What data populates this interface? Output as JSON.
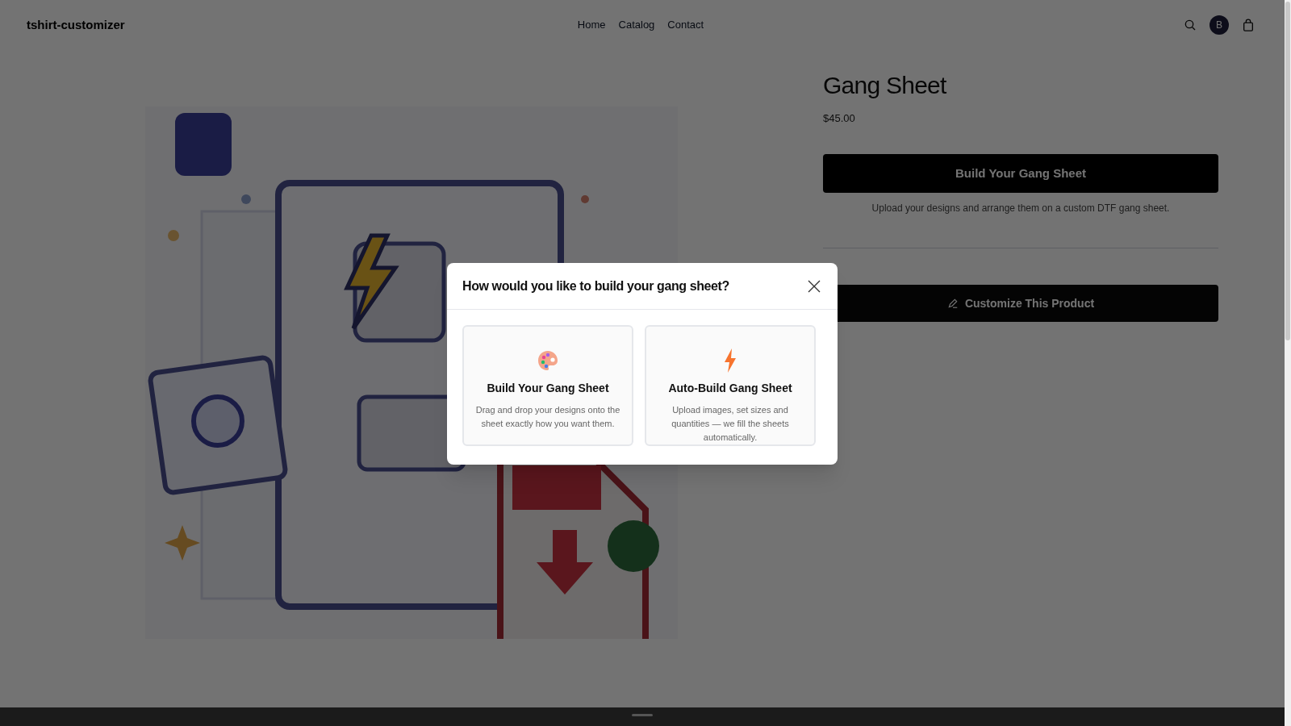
{
  "header": {
    "brand": "tshirt-customizer",
    "nav": [
      {
        "label": "Home"
      },
      {
        "label": "Catalog"
      },
      {
        "label": "Contact"
      }
    ],
    "avatar": "B"
  },
  "product": {
    "title": "Gang Sheet",
    "price": "$45.00",
    "primary_button": "Build Your Gang Sheet",
    "helper_text": "Upload your designs and arrange them on a custom DTF gang sheet.",
    "secondary_button": "Customize This Product"
  },
  "modal": {
    "title": "How would you like to build your gang sheet?",
    "options": [
      {
        "kind": "manual",
        "title": "Build Your Gang Sheet",
        "description": "Drag and drop your designs onto the sheet exactly how you want them."
      },
      {
        "kind": "auto",
        "title": "Auto-Build Gang Sheet",
        "description": "Upload images, set sizes and quantities — we fill the sheets automatically."
      }
    ]
  }
}
